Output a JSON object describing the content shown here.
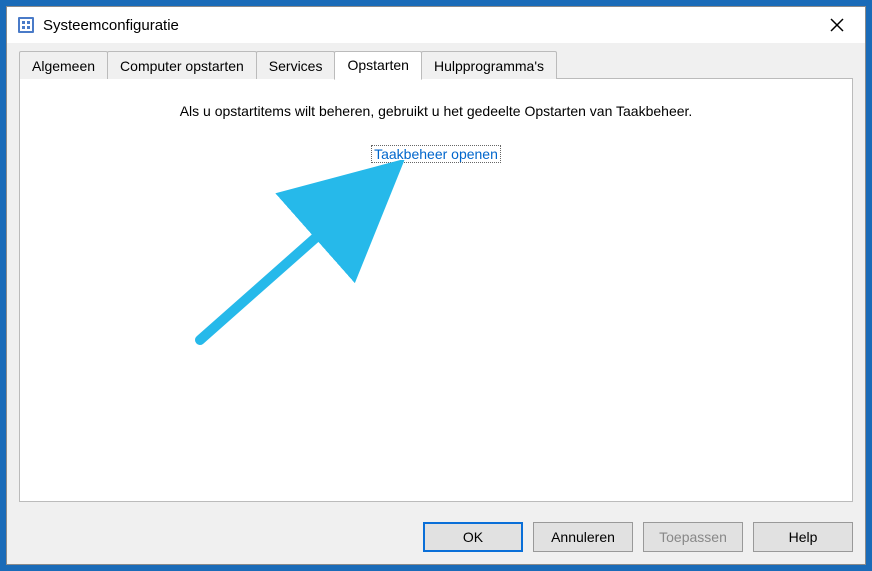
{
  "window": {
    "title": "Systeemconfiguratie"
  },
  "tabs": {
    "items": [
      {
        "label": "Algemeen"
      },
      {
        "label": "Computer opstarten"
      },
      {
        "label": "Services"
      },
      {
        "label": "Opstarten"
      },
      {
        "label": "Hulpprogramma's"
      }
    ],
    "activeIndex": 3
  },
  "panel": {
    "info": "Als u opstartitems wilt beheren, gebruikt u het gedeelte Opstarten van Taakbeheer.",
    "link": "Taakbeheer openen"
  },
  "buttons": {
    "ok": "OK",
    "cancel": "Annuleren",
    "apply": "Toepassen",
    "help": "Help"
  }
}
